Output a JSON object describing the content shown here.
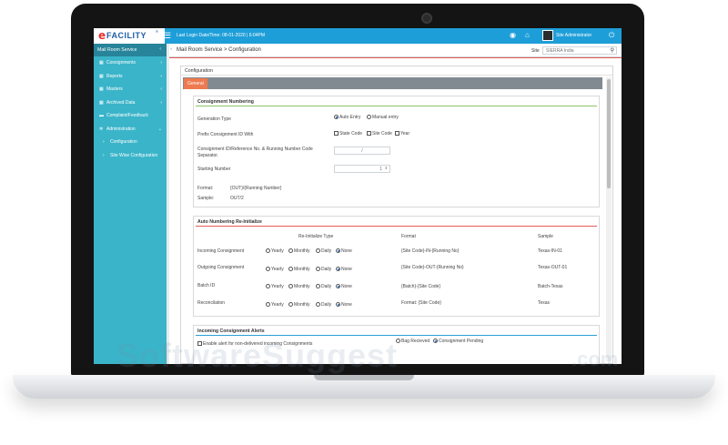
{
  "app": {
    "logo_e": "e",
    "logo_rest": "FACILITY",
    "logo_mark": "®",
    "last_login": "Last Login Date/Time: 08-01-2020 | 6:04PM",
    "user": "Site Administrator"
  },
  "sidebar": {
    "header": "Mail Room Service",
    "items": [
      {
        "label": "Consignments",
        "icon": "grid-icon"
      },
      {
        "label": "Reports",
        "icon": "grid-icon"
      },
      {
        "label": "Masters",
        "icon": "grid-icon"
      },
      {
        "label": "Archived Data",
        "icon": "grid-icon"
      },
      {
        "label": "Complaint/Feedback",
        "icon": "comment-icon"
      },
      {
        "label": "Administration",
        "icon": "gear-icon"
      }
    ],
    "subitems": [
      {
        "label": "Configuration"
      },
      {
        "label": "Site Wise Configuration"
      }
    ]
  },
  "header": {
    "breadcrumb": "Mail Room Service > Configuration",
    "site_label": "Site",
    "site_value": "SIERRA India"
  },
  "panel": {
    "title": "Configuration",
    "tab": "General"
  },
  "consignment_numbering": {
    "title": "Consignment Numbering",
    "generation_type_label": "Generation Type",
    "auto_entry": "Auto Entry",
    "manual_entry": "Manual entry",
    "prefix_label": "Prefix Consignment ID With",
    "state_code": "State Code",
    "site_code": "Site Code",
    "year": "Year",
    "separator_label": "Consignment ID/Reference No. & Running Number Code Separator.",
    "separator_value": "/",
    "starting_number_label": "Starting Number",
    "starting_number_value": "1",
    "format_label": "Format:",
    "format_value": "{OUT}/{Running Number}",
    "sample_label": "Sample:",
    "sample_value": "OUT/2"
  },
  "auto_numbering": {
    "title": "Auto Numbering Re-Initialize",
    "col_reinit": "Re-Initialize Type",
    "col_format": "Format",
    "col_sample": "Sample",
    "options": [
      "Yearly",
      "Monthly",
      "Daily",
      "None"
    ],
    "rows": [
      {
        "label": "Incoming Consignment",
        "format": "{Site Code}-IN-{Running No}",
        "sample": "Texas-IN-01"
      },
      {
        "label": "Outgoing Consignment",
        "format": "{Site Code}-OUT-{Running No}",
        "sample": "Texas-OUT-01"
      },
      {
        "label": "Batch ID",
        "format": "{Batch}-{Site Code}",
        "sample": "Batch-Texas"
      },
      {
        "label": "Reconcilation",
        "format": "Format: {Site Code}",
        "sample": "Texas"
      }
    ]
  },
  "alerts": {
    "title": "Incoming Consignment Alerts",
    "enable_label": "Enable alert for non-delivered incoming Consignments",
    "bag_received": "Bag Recieved",
    "consignment_pending": "Consignment Pending"
  },
  "watermark": {
    "text": "SoftwareSuggest",
    "suffix": ".com"
  },
  "colors": {
    "topbar": "#1e9ed8",
    "sidebar": "#3ab4c9",
    "tab": "#ee7a4f"
  }
}
